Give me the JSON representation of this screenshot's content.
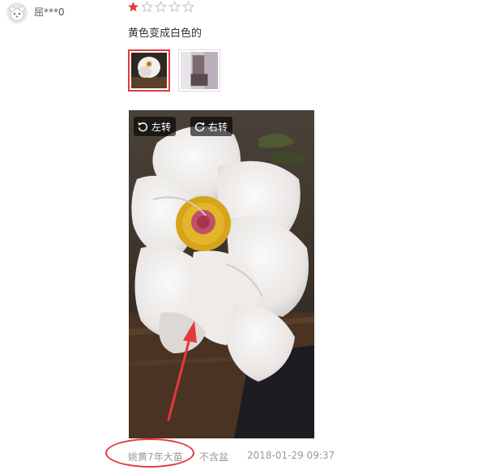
{
  "review": {
    "username": "屈***0",
    "rating": 1,
    "rating_max": 5,
    "text": "黄色变成白色的"
  },
  "thumbnails": [
    {
      "icon": "flower-photo-thumbnail",
      "selected": true
    },
    {
      "icon": "plant-photo-thumbnail",
      "selected": false
    }
  ],
  "viewer": {
    "rotate_left_label": "左转",
    "rotate_right_label": "右转"
  },
  "meta": {
    "variant": "姚黄7年大苗",
    "pot": "不含盆",
    "date": "2018-01-29 09:37"
  },
  "colors": {
    "accent": "#e4393c",
    "meta_text": "#999999"
  }
}
